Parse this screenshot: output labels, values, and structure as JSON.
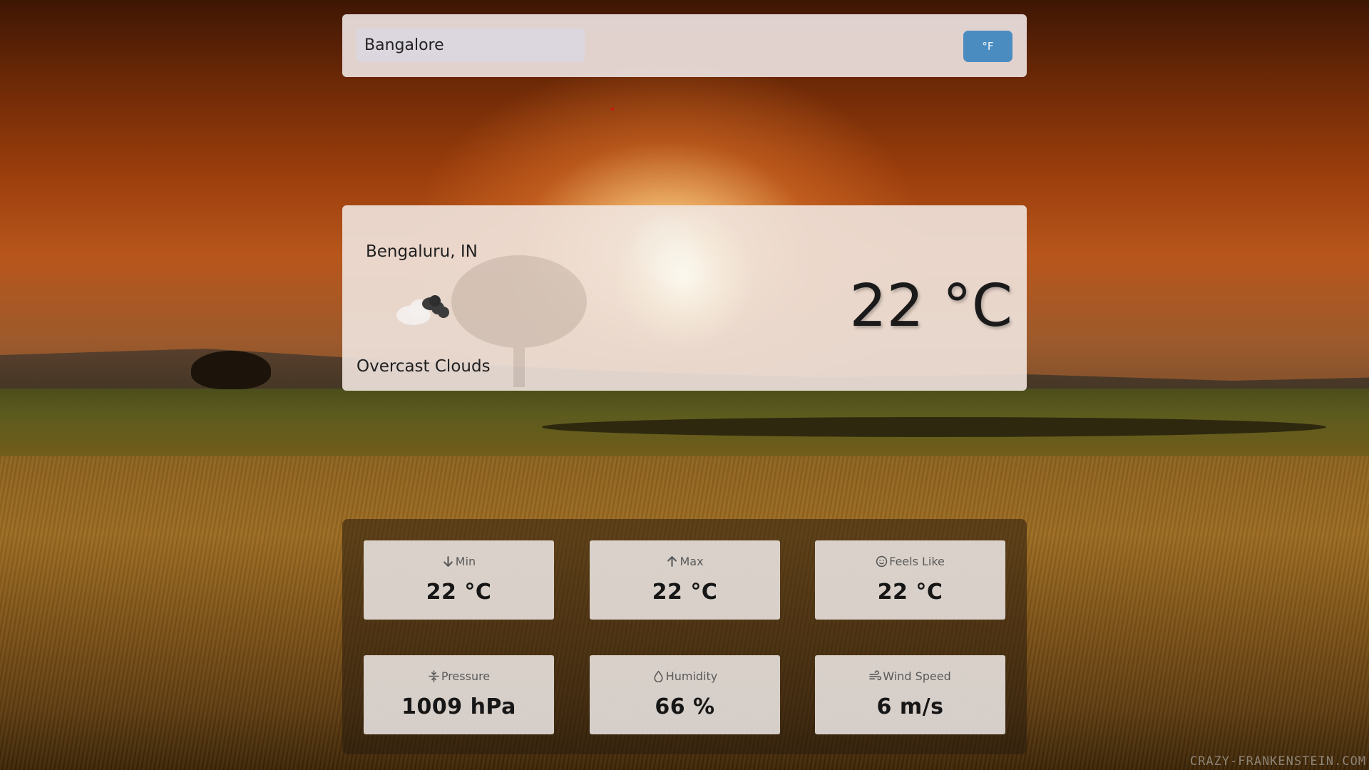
{
  "search": {
    "value": "Bangalore",
    "unit_toggle_label": "°F"
  },
  "current": {
    "location": "Bengaluru, IN",
    "temperature": "22 °C",
    "description": "Overcast Clouds",
    "icon": "overcast-clouds-icon"
  },
  "stats": [
    {
      "label": "Min",
      "value": "22 °C",
      "icon": "arrow-down-icon"
    },
    {
      "label": "Max",
      "value": "22 °C",
      "icon": "arrow-up-icon"
    },
    {
      "label": "Feels Like",
      "value": "22 °C",
      "icon": "smiley-face-icon"
    },
    {
      "label": "Pressure",
      "value": "1009 hPa",
      "icon": "compress-arrows-icon"
    },
    {
      "label": "Humidity",
      "value": "66 %",
      "icon": "droplet-icon"
    },
    {
      "label": "Wind Speed",
      "value": "6 m/s",
      "icon": "wind-icon"
    }
  ],
  "watermark": "CRAZY-FRANKENSTEIN.COM",
  "colors": {
    "accent": "#4a8cc0",
    "panel": "#ece0de"
  }
}
